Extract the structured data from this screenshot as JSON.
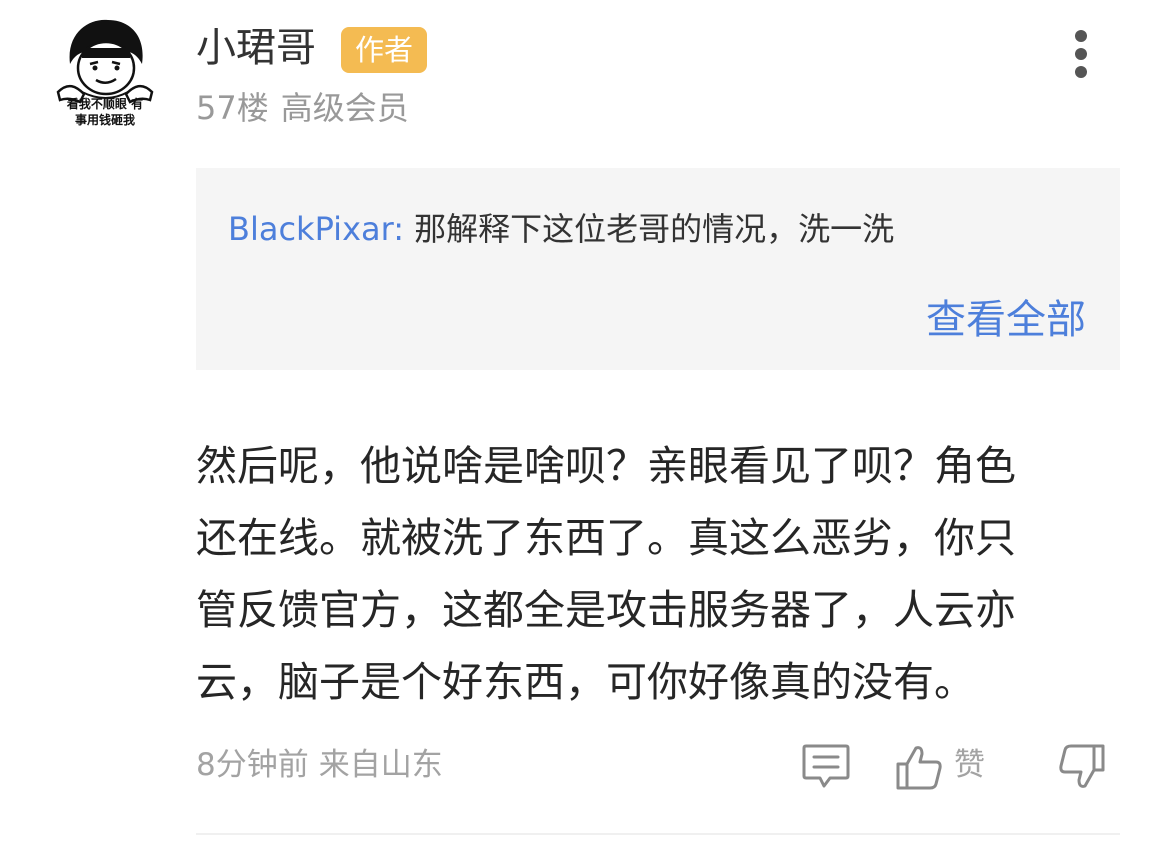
{
  "comment": {
    "user": {
      "name": "小珺哥",
      "badge": "作者",
      "floor": "57楼",
      "level": "高级会员",
      "avatar_caption_line1": "看我不顺眼 有",
      "avatar_caption_line2": "事用钱砸我"
    },
    "quote": {
      "author": "BlackPixar:",
      "text": "那解释下这位老哥的情况，洗一洗",
      "view_all": "查看全部"
    },
    "body_lines": [
      "然后呢，他说啥是啥呗？亲眼看见了呗？角色",
      "还在线。就被洗了东西了。真这么恶劣，你只",
      "管反馈官方，这都全是攻击服务器了，人云亦",
      "云，脑子是个好东西，可你好像真的没有。"
    ],
    "meta": {
      "time": "8分钟前",
      "location": "来自山东"
    },
    "actions": {
      "like_label": "赞"
    }
  },
  "icons": {
    "more": "more-vertical-icon",
    "reply": "comment-icon",
    "like": "thumbs-up-icon",
    "dislike": "thumbs-down-icon"
  },
  "colors": {
    "badge": "#f4bb52",
    "link": "#4d7fdb",
    "quote_bg": "#f5f5f5",
    "muted": "#999999",
    "body_text": "#262626"
  }
}
